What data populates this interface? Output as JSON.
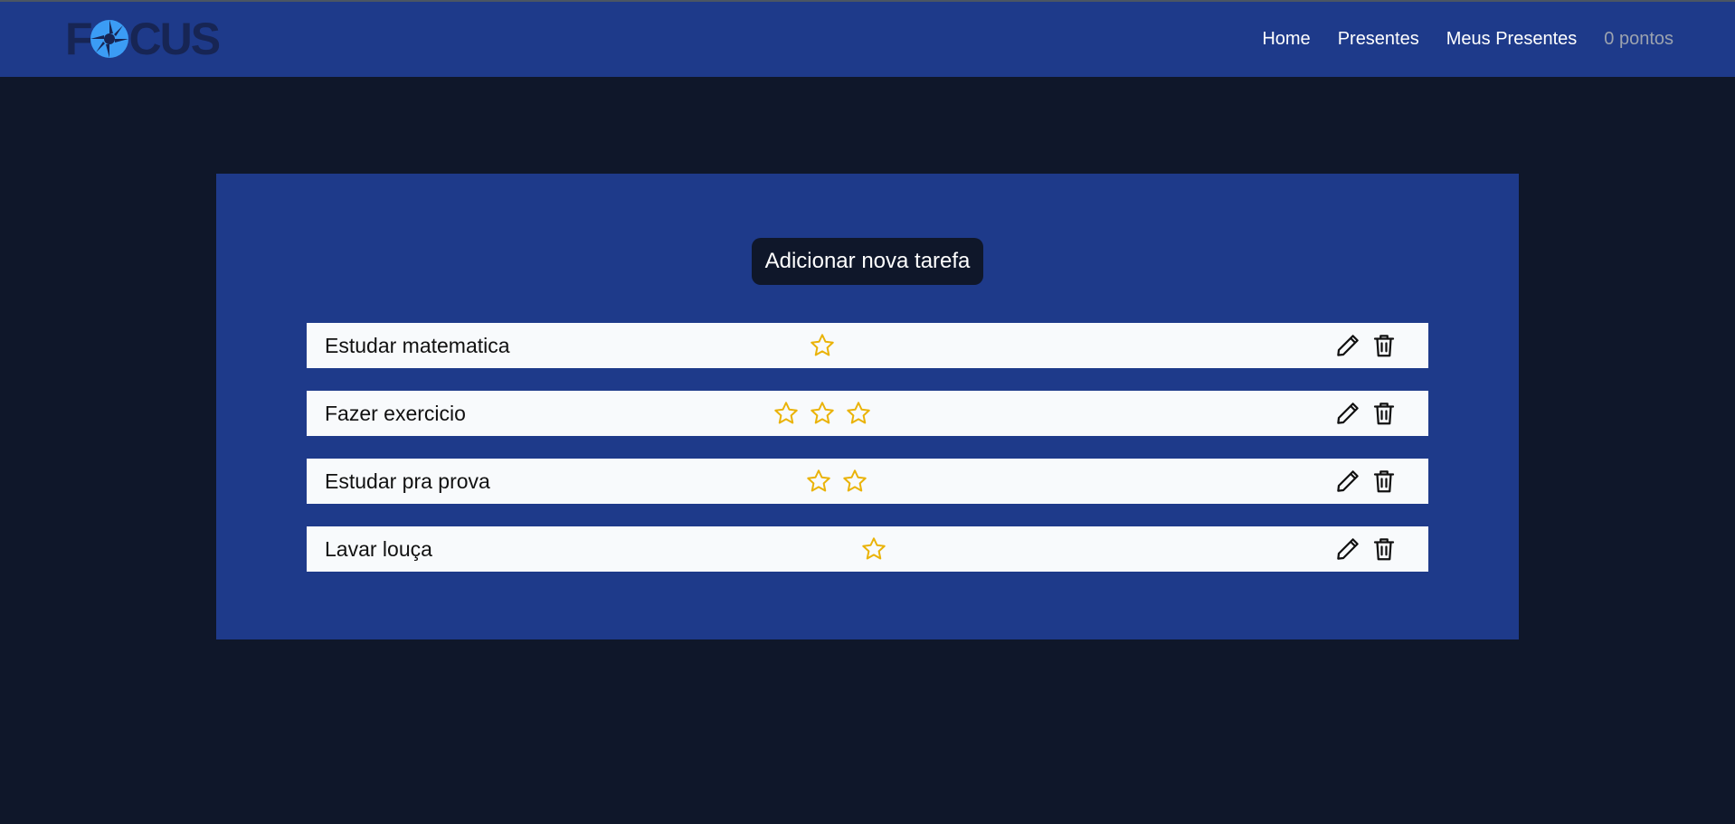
{
  "brand": {
    "logo_text": "FOCUS",
    "logo_prefix": "F",
    "logo_suffix": "CUS",
    "colors": {
      "navbar": "#1e3a8a",
      "logo_dark": "#172554",
      "logo_accent": "#3b9cf5"
    }
  },
  "nav": {
    "links": [
      {
        "label": "Home"
      },
      {
        "label": "Presentes"
      },
      {
        "label": "Meus Presentes"
      }
    ],
    "points_label": "0 pontos"
  },
  "main": {
    "add_task_label": "Adicionar nova tarefa",
    "tasks": [
      {
        "name": "Estudar matematica",
        "stars": 1
      },
      {
        "name": "Fazer exercicio",
        "stars": 3
      },
      {
        "name": "Estudar pra prova",
        "stars": 2
      },
      {
        "name": "Lavar louça",
        "stars": 1
      }
    ],
    "icons": {
      "star": "star-outline-icon",
      "edit": "pencil-icon",
      "delete": "trash-icon"
    },
    "colors": {
      "background": "#0f172a",
      "panel": "#1e3a8a",
      "row": "#f8fafc",
      "star": "#eab308"
    }
  }
}
